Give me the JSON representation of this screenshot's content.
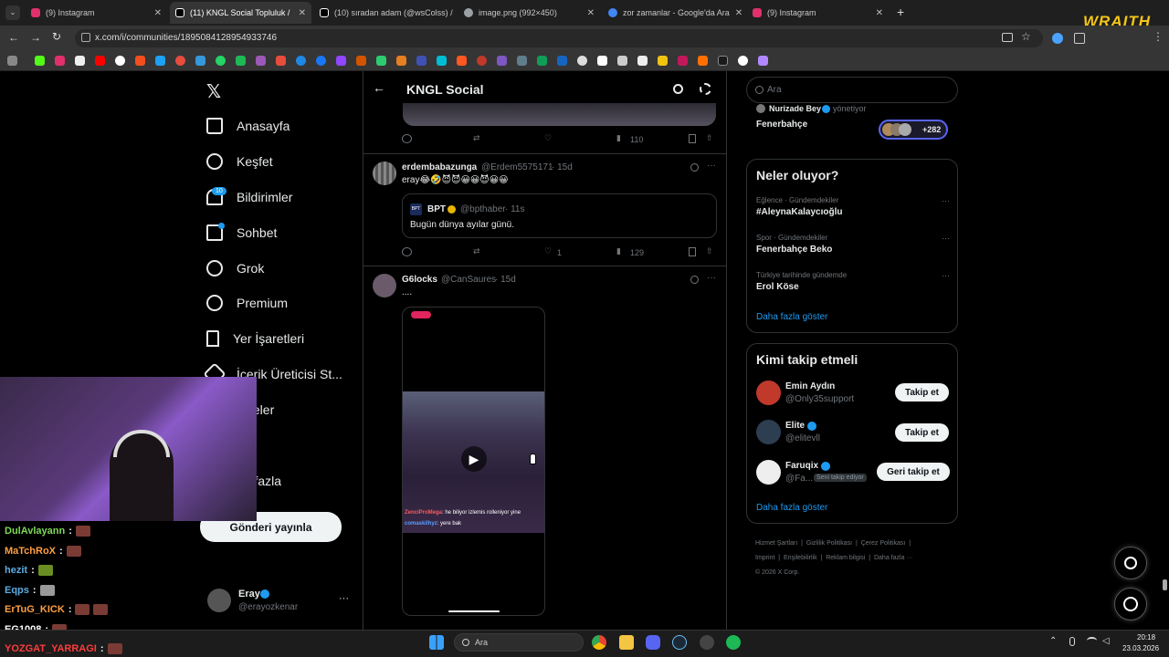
{
  "browser": {
    "tabs": [
      {
        "title": "(9) Instagram",
        "active": false,
        "color": "#e1306c"
      },
      {
        "title": "(11) KNGL Social Topluluk /",
        "active": true,
        "color": "#ffffff"
      },
      {
        "title": "(10) sıradan adam (@wsColss) /",
        "active": false,
        "color": "#ffffff"
      },
      {
        "title": "image.png (992×450)",
        "active": false,
        "color": "#9aa0a6"
      },
      {
        "title": "zor zamanlar - Google'da Ara",
        "active": false,
        "color": "#4285f4"
      },
      {
        "title": "(9) Instagram",
        "active": false,
        "color": "#e1306c"
      }
    ],
    "new_tab": "+",
    "url": "x.com/i/communities/1895084128954933746",
    "overlay_logo": "WRAITH"
  },
  "sidebar": {
    "items": [
      {
        "label": "Anasayfa",
        "icon": "home-icon"
      },
      {
        "label": "Keşfet",
        "icon": "search-icon"
      },
      {
        "label": "Bildirimler",
        "icon": "bell-icon",
        "badge": "10"
      },
      {
        "label": "Sohbet",
        "icon": "mail-icon"
      },
      {
        "label": "Grok",
        "icon": "grok-icon"
      },
      {
        "label": "Premium",
        "icon": "premium-icon"
      },
      {
        "label": "Yer İşaretleri",
        "icon": "bookmark-icon"
      },
      {
        "label": "İçerik Üreticisi St...",
        "icon": "rocket-icon"
      },
      {
        "label": "kaleler",
        "icon": "article-icon"
      },
      {
        "label": "fil",
        "icon": "profile-icon"
      },
      {
        "label": "ha fazla",
        "icon": "more-icon"
      }
    ],
    "post_button": "Gönderi yayınla",
    "account": {
      "name": "Eray",
      "handle": "@erayozkenar",
      "more": "···"
    }
  },
  "header": {
    "title": "KNGL Social",
    "back": "←"
  },
  "feed": {
    "first_actions": {
      "views": "110"
    },
    "tweets": [
      {
        "name": "erdembabazunga",
        "handle": "@Erdem5575171",
        "time": "· 15d",
        "text": "eray😂🤣😈😈😀😀😈😀😀",
        "quote": {
          "name": "BPT",
          "handle": "@bpthaber",
          "time": "· 11s",
          "text": "Bugün dünya ayılar günü."
        },
        "likes": "1",
        "views": "129"
      },
      {
        "name": "G6locks",
        "handle": "@CanSaures",
        "time": "· 15d",
        "text": "....",
        "video_caption_user": "ZenciProMega",
        "video_caption_text": ": he biliyor izlemis rolleniyor yine",
        "video_caption_user2": "comaskilhyz",
        "video_caption_text2": ": yere bak"
      }
    ]
  },
  "right": {
    "search_placeholder": "Ara",
    "community": {
      "managed_by": "Nurizade Bey",
      "role": "yönetiyor",
      "name": "Fenerbahçe",
      "member_count": "+282"
    },
    "trends_title": "Neler oluyor?",
    "trends": [
      {
        "meta": "Eğlence · Gündemdekiler",
        "title": "#AleynaKalaycıoğlu"
      },
      {
        "meta": "Spor · Gündemdekiler",
        "title": "Fenerbahçe Beko"
      },
      {
        "meta": "Türkiye tarihinde gündemde",
        "title": "Erol Köse"
      }
    ],
    "trends_more": "Daha fazla göster",
    "who_title": "Kimi takip etmeli",
    "who": [
      {
        "name": "Emin Aydın",
        "handle": "@Only35support",
        "button": "Takip et",
        "verified": false,
        "color": "#c0392b"
      },
      {
        "name": "Elite",
        "handle": "@elitevll",
        "button": "Takip et",
        "verified": true,
        "color": "#2c3e50"
      },
      {
        "name": "Faruqix",
        "handle": "@Fa...",
        "follows_you": "Seni takip ediyor",
        "button": "Geri takip et",
        "verified": true,
        "color": "#444444"
      }
    ],
    "who_more": "Daha fazla göster",
    "footer": [
      "Hizmet Şartları",
      "Gizlilik Politikası",
      "Çerez Politikası",
      "Imprint",
      "Erişilebilirlik",
      "Reklam bilgisi",
      "Daha fazla ···"
    ],
    "copyright": "© 2026 X Corp."
  },
  "chat": [
    {
      "user": "DulAvlayann",
      "color": "#7ed957"
    },
    {
      "user": "MaTchRoX",
      "color": "#ff9f43"
    },
    {
      "user": "hezit",
      "color": "#5dade2"
    },
    {
      "user": "Eqps",
      "color": "#5dade2"
    },
    {
      "user": "ErTuG_KICK",
      "color": "#ff9f43"
    },
    {
      "user": "EG1008",
      "color": "#ffffff"
    },
    {
      "user": "YOZGAT_YARRAGI",
      "color": "#ff3b3b"
    }
  ],
  "taskbar": {
    "search": "Ara",
    "time": "20:18",
    "date": "23.03.2026"
  }
}
